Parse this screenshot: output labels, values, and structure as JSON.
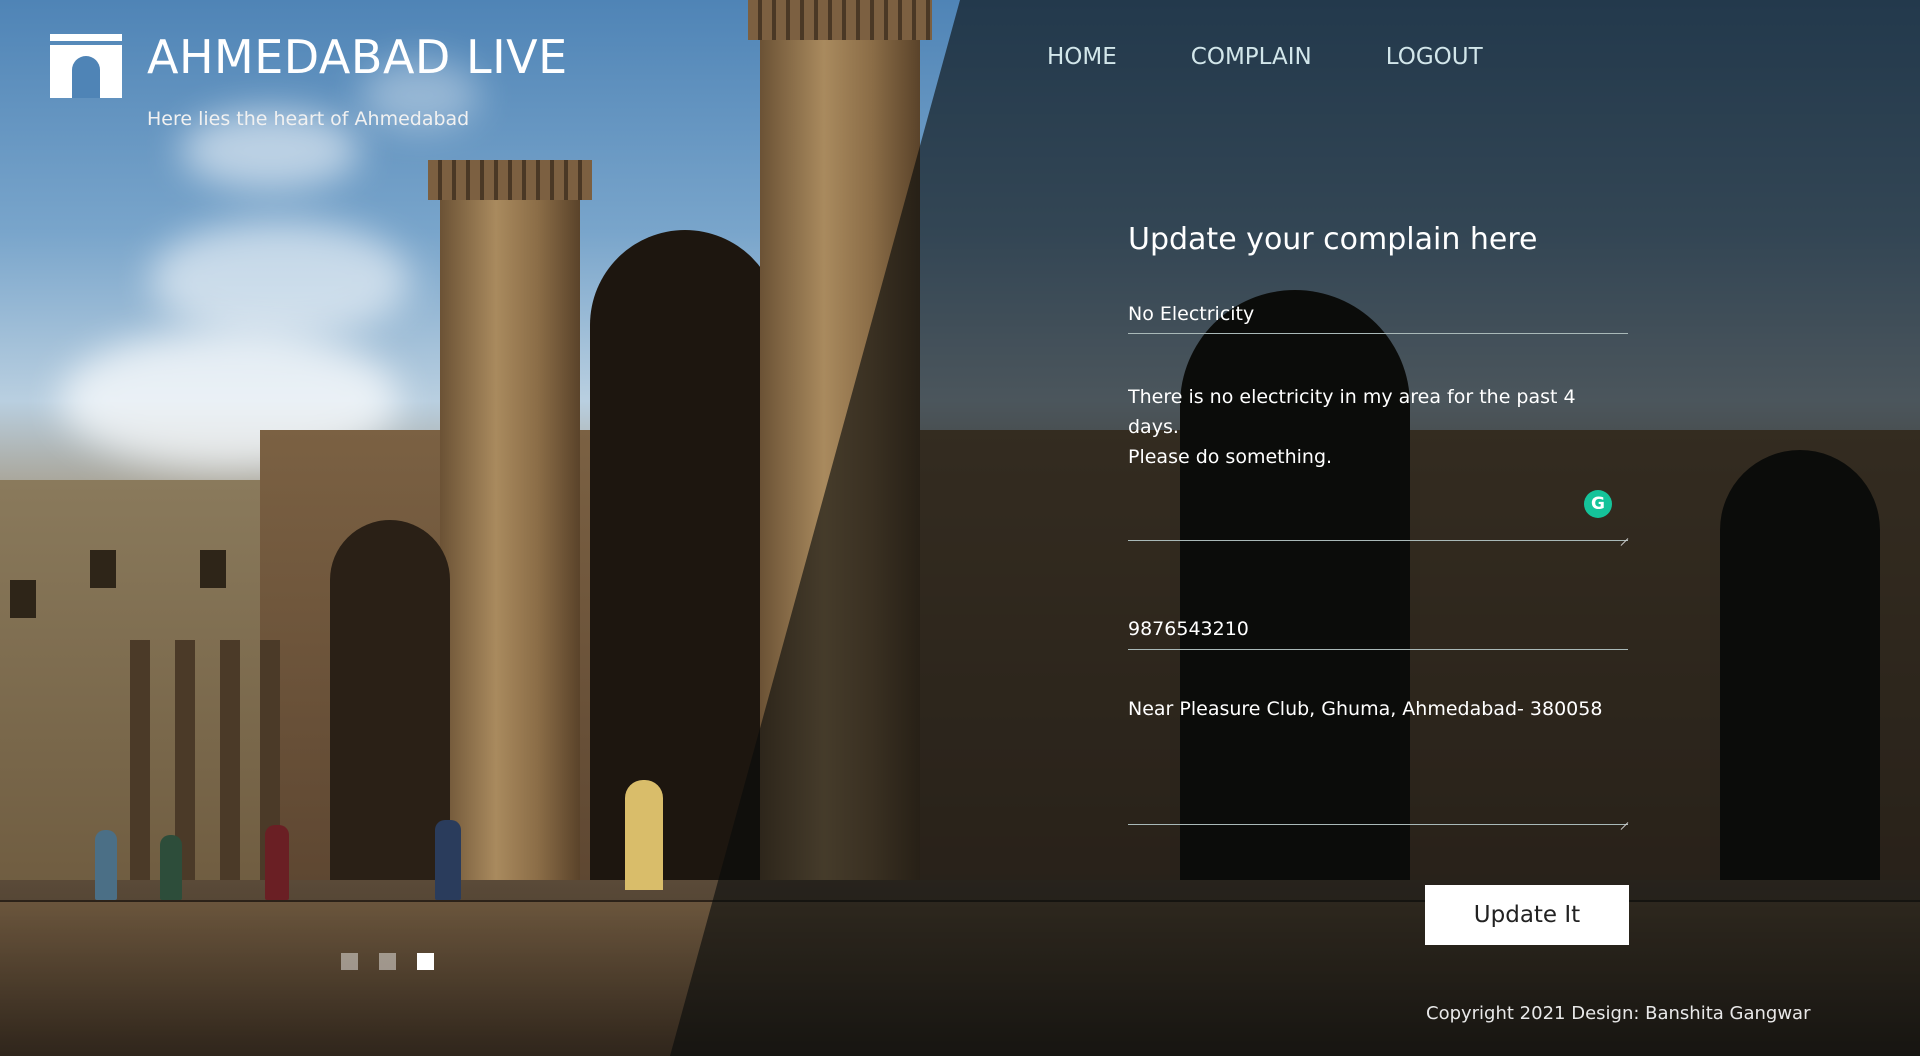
{
  "brand": {
    "title": "AHMEDABAD LIVE",
    "tagline": "Here lies the heart of Ahmedabad",
    "logo_icon": "gate-icon"
  },
  "nav": {
    "items": [
      {
        "label": "HOME"
      },
      {
        "label": "COMPLAIN"
      },
      {
        "label": "LOGOUT"
      }
    ]
  },
  "form": {
    "title": "Update your complain here",
    "subject_value": "No Electricity",
    "description_value": "There is no electricity in my area for the past 4 days.\nPlease do something.",
    "phone_value": "9876543210",
    "address_value": "Near Pleasure Club, Ghuma, Ahmedabad- 380058",
    "grammar_icon": "grammarly-icon",
    "grammar_badge_letter": "G",
    "submit_label": "Update It"
  },
  "slider": {
    "dots": 3,
    "active_index": 2
  },
  "footer": {
    "copyright": "Copyright 2021 Design: Banshita Gangwar"
  },
  "colors": {
    "overlay": "#080c0c",
    "nav_text": "#d2e6ea",
    "badge": "#15c39a",
    "button_bg": "#ffffff"
  }
}
